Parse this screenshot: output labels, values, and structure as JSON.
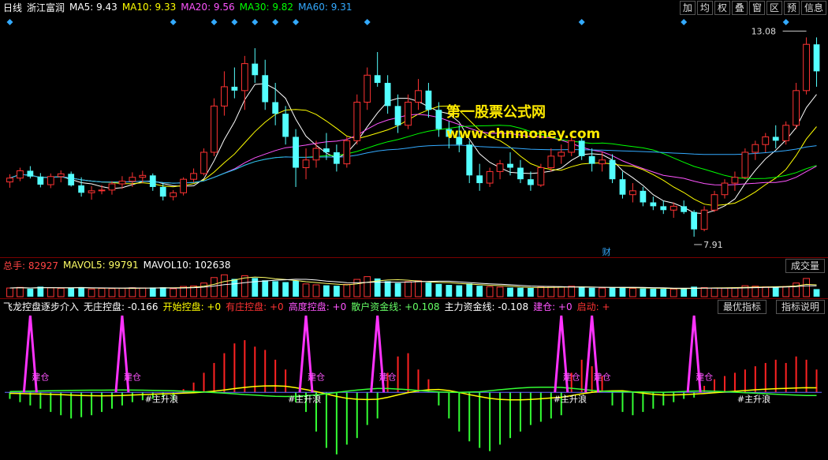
{
  "header": {
    "period": "日线",
    "stock_name": "浙江富润",
    "ma": [
      {
        "label": "MA5: 9.43",
        "color": "#ffffff"
      },
      {
        "label": "MA10: 9.33",
        "color": "#ffff00"
      },
      {
        "label": "MA20: 9.56",
        "color": "#ff55ff"
      },
      {
        "label": "MA30: 9.82",
        "color": "#00ff00"
      },
      {
        "label": "MA60: 9.31",
        "color": "#33aaff"
      }
    ],
    "toolbar": [
      "加",
      "均",
      "权",
      "叠",
      "窗",
      "区",
      "预",
      "信息"
    ]
  },
  "price_panel": {
    "high_label": "13.08",
    "low_label": "7.91",
    "marker_label": "财",
    "watermark_cn": "第一股票公式网",
    "watermark_url": "www.chnmoney.com"
  },
  "volume_panel": {
    "items": [
      {
        "label": "总手: 82927",
        "color": "#ff4444"
      },
      {
        "label": "MAVOL5: 99791",
        "color": "#ffff66"
      },
      {
        "label": "MAVOL10: 102638",
        "color": "#ffffff"
      }
    ],
    "button": "成交量"
  },
  "indicator_panel": {
    "items": [
      {
        "label": "飞龙控盘逐步介入",
        "color": "#ffffff"
      },
      {
        "label": "无庄控盘: -0.166",
        "color": "#ffffff"
      },
      {
        "label": "开始控盘: +0",
        "color": "#ffff00"
      },
      {
        "label": "有庄控盘: +0",
        "color": "#ff3333"
      },
      {
        "label": "高度控盘: +0",
        "color": "#ff55ff"
      },
      {
        "label": "散户资金线: +0.108",
        "color": "#66ff66"
      },
      {
        "label": "主力资金线: -0.108",
        "color": "#ffffff"
      },
      {
        "label": "建仓: +0",
        "color": "#ff55ff"
      },
      {
        "label": "启动: +",
        "color": "#ff3333"
      }
    ],
    "buttons": [
      "最优指标",
      "指标说明"
    ],
    "jiancang_label": "建仓",
    "zhusheng_label": "#主升浪"
  },
  "chart_data": [
    {
      "type": "candlestick",
      "title": "浙江富润 日线",
      "ylim": [
        7.5,
        13.6
      ],
      "annotations": {
        "high": 13.08,
        "low": 7.91
      },
      "ohlc": [
        [
          9.33,
          9.53,
          9.18,
          9.43
        ],
        [
          9.43,
          9.7,
          9.35,
          9.62
        ],
        [
          9.62,
          9.74,
          9.42,
          9.47
        ],
        [
          9.47,
          9.56,
          9.19,
          9.26
        ],
        [
          9.26,
          9.55,
          9.17,
          9.47
        ],
        [
          9.47,
          9.63,
          9.32,
          9.54
        ],
        [
          9.54,
          9.6,
          9.21,
          9.24
        ],
        [
          9.24,
          9.45,
          8.95,
          9.05
        ],
        [
          9.05,
          9.22,
          8.87,
          9.1
        ],
        [
          9.1,
          9.25,
          9.01,
          9.12
        ],
        [
          9.12,
          9.35,
          9.0,
          9.28
        ],
        [
          9.28,
          9.48,
          9.15,
          9.35
        ],
        [
          9.35,
          9.58,
          9.2,
          9.45
        ],
        [
          9.45,
          9.62,
          9.3,
          9.5
        ],
        [
          9.5,
          9.55,
          9.1,
          9.2
        ],
        [
          9.2,
          9.3,
          8.85,
          8.95
        ],
        [
          8.95,
          9.12,
          8.85,
          9.05
        ],
        [
          9.05,
          9.45,
          8.98,
          9.4
        ],
        [
          9.4,
          9.68,
          9.32,
          9.55
        ],
        [
          9.55,
          10.2,
          9.5,
          10.1
        ],
        [
          10.1,
          11.5,
          10.0,
          11.3
        ],
        [
          11.3,
          12.2,
          11.05,
          11.8
        ],
        [
          11.8,
          12.3,
          11.5,
          11.7
        ],
        [
          11.7,
          12.6,
          11.2,
          12.4
        ],
        [
          12.4,
          12.8,
          11.9,
          12.1
        ],
        [
          12.1,
          12.5,
          11.2,
          11.4
        ],
        [
          11.4,
          11.9,
          10.8,
          11.1
        ],
        [
          11.1,
          11.3,
          10.3,
          10.5
        ],
        [
          10.5,
          10.7,
          9.2,
          9.7
        ],
        [
          9.7,
          10.2,
          9.4,
          9.9
        ],
        [
          9.9,
          10.4,
          9.7,
          10.2
        ],
        [
          10.2,
          10.6,
          9.9,
          10.1
        ],
        [
          10.1,
          10.3,
          9.6,
          9.8
        ],
        [
          9.8,
          10.5,
          9.7,
          10.4
        ],
        [
          10.4,
          11.6,
          10.3,
          11.4
        ],
        [
          11.4,
          12.3,
          11.2,
          12.1
        ],
        [
          12.1,
          12.7,
          11.8,
          11.9
        ],
        [
          11.9,
          12.1,
          11.1,
          11.3
        ],
        [
          11.3,
          11.6,
          10.6,
          10.8
        ],
        [
          10.8,
          11.6,
          10.7,
          11.4
        ],
        [
          11.4,
          12.0,
          11.2,
          11.7
        ],
        [
          11.7,
          11.9,
          11.0,
          11.2
        ],
        [
          11.2,
          11.4,
          10.5,
          10.7
        ],
        [
          10.7,
          10.9,
          10.2,
          10.5
        ],
        [
          10.5,
          10.8,
          10.1,
          10.3
        ],
        [
          10.3,
          10.4,
          9.3,
          9.5
        ],
        [
          9.5,
          9.8,
          9.1,
          9.3
        ],
        [
          9.3,
          9.7,
          9.2,
          9.6
        ],
        [
          9.6,
          9.9,
          9.4,
          9.8
        ],
        [
          9.8,
          10.1,
          9.5,
          9.7
        ],
        [
          9.7,
          9.9,
          9.3,
          9.4
        ],
        [
          9.4,
          9.6,
          9.1,
          9.25
        ],
        [
          9.25,
          9.8,
          9.2,
          9.7
        ],
        [
          9.7,
          10.2,
          9.6,
          10.0
        ],
        [
          10.0,
          10.3,
          9.8,
          10.1
        ],
        [
          10.1,
          10.6,
          10.0,
          10.4
        ],
        [
          10.4,
          10.5,
          9.9,
          10.0
        ],
        [
          10.0,
          10.2,
          9.6,
          9.8
        ],
        [
          9.8,
          10.1,
          9.6,
          9.9
        ],
        [
          9.9,
          10.05,
          9.3,
          9.4
        ],
        [
          9.4,
          9.6,
          8.9,
          9.0
        ],
        [
          9.0,
          9.3,
          8.8,
          9.1
        ],
        [
          9.1,
          9.2,
          8.7,
          8.8
        ],
        [
          8.8,
          8.95,
          8.6,
          8.7
        ],
        [
          8.7,
          8.85,
          8.5,
          8.6
        ],
        [
          8.6,
          8.8,
          8.4,
          8.7
        ],
        [
          8.7,
          8.85,
          8.5,
          8.55
        ],
        [
          8.55,
          8.6,
          7.91,
          8.1
        ],
        [
          8.1,
          8.7,
          8.05,
          8.6
        ],
        [
          8.6,
          9.1,
          8.55,
          9.0
        ],
        [
          9.0,
          9.4,
          8.9,
          9.3
        ],
        [
          9.3,
          9.6,
          9.1,
          9.45
        ],
        [
          9.45,
          10.2,
          9.4,
          10.1
        ],
        [
          10.1,
          10.4,
          9.9,
          10.3
        ],
        [
          10.3,
          10.6,
          10.1,
          10.5
        ],
        [
          10.5,
          10.8,
          10.2,
          10.4
        ],
        [
          10.4,
          10.9,
          10.3,
          10.8
        ],
        [
          10.8,
          11.9,
          10.7,
          11.7
        ],
        [
          11.7,
          13.08,
          11.6,
          12.9
        ],
        [
          12.9,
          13.08,
          11.8,
          12.2
        ]
      ],
      "ma_colors": [
        "#ffffff",
        "#ffff00",
        "#ff55ff",
        "#00ff00",
        "#33aaff"
      ]
    },
    {
      "type": "bar",
      "title": "成交量",
      "ylim": [
        0,
        260000
      ],
      "values": [
        95000,
        102000,
        88000,
        110000,
        97000,
        92000,
        99000,
        105000,
        84000,
        91000,
        89000,
        93000,
        98000,
        96000,
        101000,
        103000,
        87000,
        112000,
        118000,
        150000,
        210000,
        240000,
        195000,
        230000,
        205000,
        180000,
        170000,
        160000,
        175000,
        140000,
        130000,
        125000,
        120000,
        135000,
        190000,
        220000,
        200000,
        170000,
        150000,
        165000,
        175000,
        155000,
        140000,
        130000,
        125000,
        145000,
        120000,
        110000,
        105000,
        100000,
        98000,
        96000,
        104000,
        112000,
        108000,
        115000,
        102000,
        97000,
        95000,
        99000,
        105000,
        92000,
        90000,
        88000,
        86000,
        84000,
        89000,
        110000,
        100000,
        96000,
        94000,
        98000,
        120000,
        115000,
        108000,
        104000,
        112000,
        150000,
        200000,
        82927
      ]
    },
    {
      "type": "bar",
      "title": "飞龙控盘逐步介入",
      "ylim": [
        -1.0,
        1.2
      ],
      "values": [
        -0.1,
        -0.15,
        -0.2,
        -0.25,
        -0.3,
        -0.35,
        -0.4,
        -0.38,
        -0.35,
        -0.3,
        -0.25,
        -0.2,
        -0.15,
        -0.12,
        -0.1,
        -0.08,
        -0.12,
        0.05,
        0.15,
        0.3,
        0.45,
        0.6,
        0.75,
        0.8,
        0.7,
        0.65,
        0.5,
        0.35,
        -0.15,
        -0.3,
        -0.6,
        -0.85,
        -0.95,
        -0.8,
        -0.7,
        -0.5,
        -0.4,
        0.3,
        0.55,
        0.6,
        0.35,
        0.2,
        -0.2,
        -0.4,
        -0.6,
        -0.75,
        -0.85,
        -0.9,
        -0.8,
        -0.7,
        -0.6,
        -0.5,
        -0.45,
        -0.4,
        -0.35,
        0.3,
        0.5,
        0.4,
        0.25,
        -0.2,
        -0.3,
        -0.35,
        -0.3,
        -0.25,
        -0.2,
        -0.15,
        -0.1,
        -0.08,
        0.1,
        0.2,
        0.25,
        0.3,
        0.35,
        0.4,
        0.45,
        0.5,
        0.45,
        0.55,
        0.5,
        0.35
      ],
      "jiancang_index": [
        2,
        11,
        29,
        36,
        54,
        57,
        67
      ],
      "zhusheng_index": [
        14,
        28,
        54,
        72
      ]
    }
  ]
}
